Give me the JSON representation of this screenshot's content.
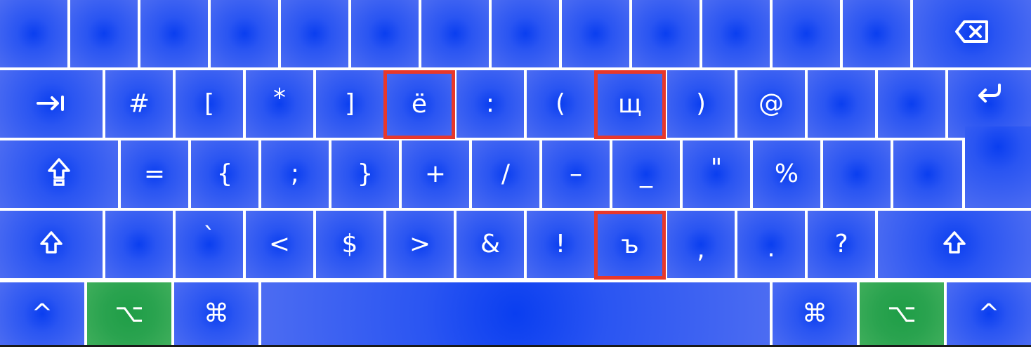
{
  "keyboard": {
    "row1": [
      "",
      "",
      "",
      "",
      "",
      "",
      "",
      "",
      "",
      "",
      "",
      "",
      "",
      ""
    ],
    "row2": {
      "symbols": [
        "#",
        "[",
        "*",
        "]",
        "ё",
        ":",
        "(",
        "щ",
        ")",
        "@",
        "",
        ""
      ]
    },
    "row3": {
      "symbols": [
        "=",
        "{",
        ";",
        "}",
        "+",
        "/",
        "–",
        "_",
        "\"",
        "%",
        "",
        ""
      ]
    },
    "row4": {
      "symbols": [
        "",
        "`",
        "<",
        "$",
        ">",
        "&",
        "!",
        "ъ",
        ",",
        ".",
        "?"
      ]
    },
    "row5": {
      "control": "^",
      "option": "⌥",
      "command": "⌘",
      "space": ""
    },
    "icons": {
      "backspace": "backspace-icon",
      "tab": "tab-icon",
      "return": "return-icon",
      "shift": "shift-icon",
      "caps": "caps-lock-icon"
    },
    "colors": {
      "key_blue": "#2a55f2",
      "option_green": "#2aa34f",
      "highlight": "#e8382a"
    },
    "highlighted_keys": [
      "ё",
      "щ",
      "ъ"
    ]
  }
}
